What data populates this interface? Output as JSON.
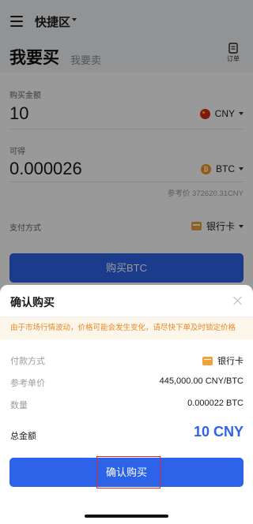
{
  "header": {
    "zone_title": "快捷区",
    "tab_buy": "我要买",
    "tab_sell": "我要卖",
    "orders_label": "订单"
  },
  "buy_form": {
    "amount_label": "购买金额",
    "amount_value": "10",
    "amount_currency": "CNY",
    "receive_label": "可得",
    "receive_value": "0.000026",
    "receive_currency": "BTC",
    "ref_price": "参考价 372620.31CNY",
    "payment_label": "支付方式",
    "payment_value": "银行卡",
    "buy_button": "购买BTC"
  },
  "confirm_sheet": {
    "title": "确认购买",
    "warning": "由于市场行情波动，价格可能会发生变化，请尽快下单及时锁定价格",
    "rows": [
      {
        "label": "付款方式",
        "value": "银行卡"
      },
      {
        "label": "参考单价",
        "value": "445,000.00 CNY/BTC"
      },
      {
        "label": "数量",
        "value": "0.000022 BTC"
      }
    ],
    "total_label": "总金额",
    "total_value": "10 CNY",
    "confirm_button": "确认购买"
  },
  "colors": {
    "accent": "#2d63e8",
    "warning_text": "#e8892b",
    "warning_bg": "#fdf6ea",
    "highlight": "#e02a2a"
  },
  "icons": {
    "menu": "menu-icon",
    "orders": "document-icon",
    "cny": "china-flag-icon",
    "btc": "bitcoin-icon",
    "bank": "bank-card-icon",
    "close": "close-icon"
  }
}
